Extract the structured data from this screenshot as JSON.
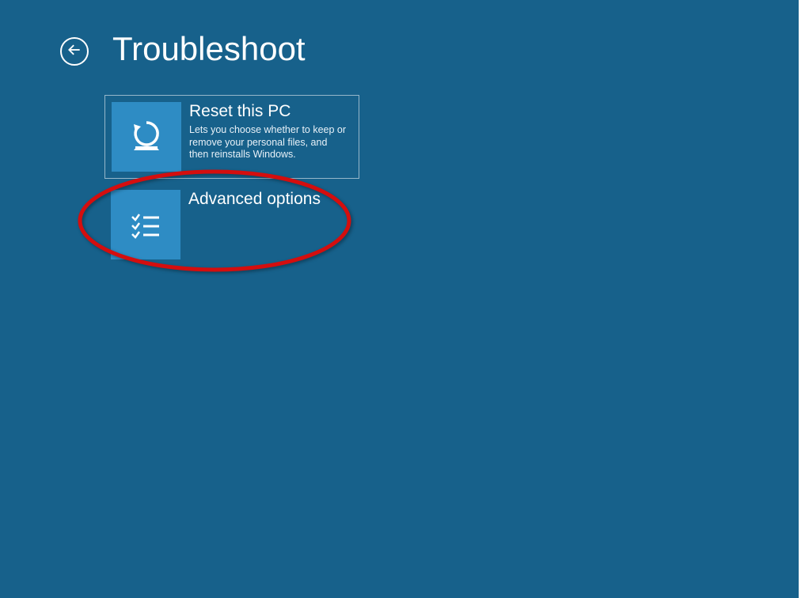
{
  "header": {
    "title": "Troubleshoot"
  },
  "tiles": [
    {
      "title": "Reset this PC",
      "description": "Lets you choose whether to keep or remove your personal files, and then reinstalls Windows.",
      "icon": "reset-icon"
    },
    {
      "title": "Advanced options",
      "description": "",
      "icon": "checklist-icon"
    }
  ],
  "annotation": {
    "circled_item": "Advanced options",
    "color": "#d40e0e"
  }
}
